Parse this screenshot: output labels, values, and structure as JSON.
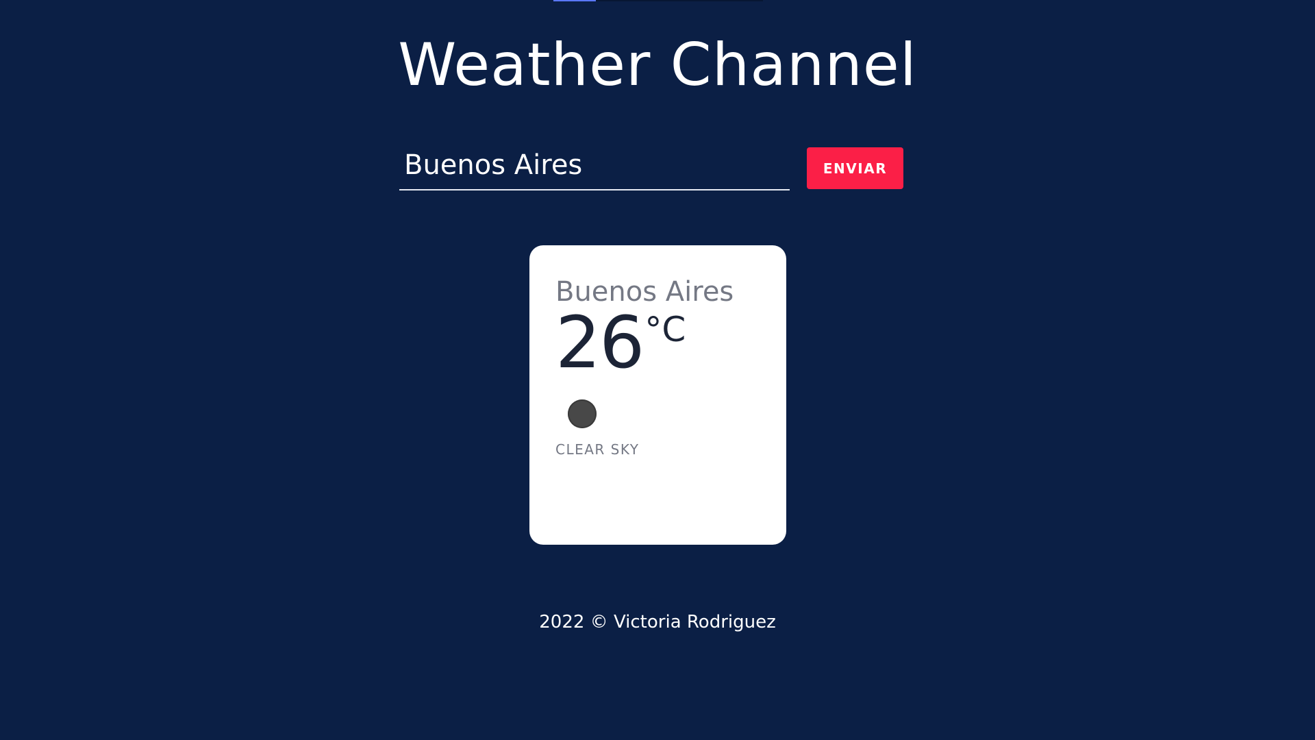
{
  "header": {
    "title": "Weather Channel"
  },
  "search": {
    "value": "Buenos Aires",
    "button_label": "ENVIAR"
  },
  "weather_card": {
    "city": "Buenos Aires",
    "temperature": "26",
    "unit": "°C",
    "icon": "weather-icon",
    "description": "CLEAR SKY"
  },
  "footer": {
    "text": "2022 © Victoria Rodriguez"
  },
  "colors": {
    "background": "#0b1f45",
    "accent": "#fb1f47",
    "card": "#ffffff",
    "top_accent": "#5a78ff"
  }
}
